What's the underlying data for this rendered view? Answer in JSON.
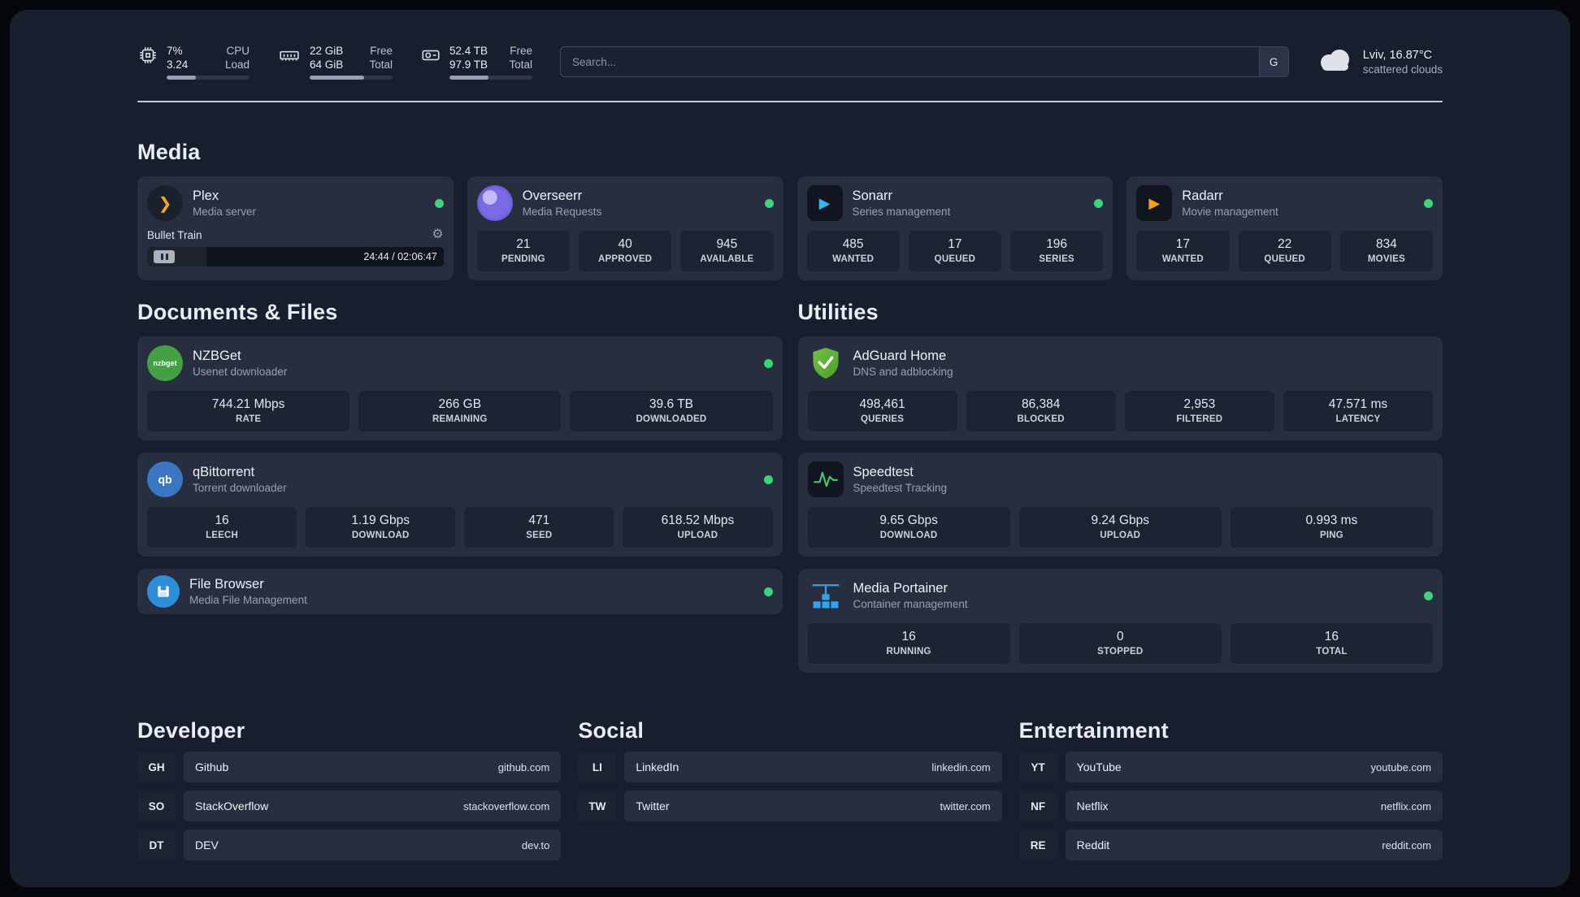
{
  "topbar": {
    "cpu": {
      "value": "7%",
      "load": "3.24",
      "label1": "CPU",
      "label2": "Load",
      "percent": 35
    },
    "memory": {
      "free": "22 GiB",
      "total": "64 GiB",
      "label1": "Free",
      "label2": "Total",
      "percent": 66
    },
    "disk": {
      "free": "52.4 TB",
      "total": "97.9 TB",
      "label1": "Free",
      "label2": "Total",
      "percent": 47
    },
    "search": {
      "placeholder": "Search...",
      "engine": "G"
    },
    "weather": {
      "location": "Lviv, 16.87°C",
      "condition": "scattered clouds"
    }
  },
  "sections": {
    "media": "Media",
    "documents": "Documents & Files",
    "utilities": "Utilities",
    "developer": "Developer",
    "social": "Social",
    "entertainment": "Entertainment"
  },
  "apps": {
    "plex": {
      "name": "Plex",
      "desc": "Media server",
      "icon_glyph": "❯",
      "now_playing": "Bullet Train",
      "time": "24:44 / 02:06:47",
      "progress": 20
    },
    "overseerr": {
      "name": "Overseerr",
      "desc": "Media Requests",
      "stats": [
        {
          "v": "21",
          "l": "PENDING"
        },
        {
          "v": "40",
          "l": "APPROVED"
        },
        {
          "v": "945",
          "l": "AVAILABLE"
        }
      ]
    },
    "sonarr": {
      "name": "Sonarr",
      "desc": "Series management",
      "icon_glyph": "▶",
      "stats": [
        {
          "v": "485",
          "l": "WANTED"
        },
        {
          "v": "17",
          "l": "QUEUED"
        },
        {
          "v": "196",
          "l": "SERIES"
        }
      ]
    },
    "radarr": {
      "name": "Radarr",
      "desc": "Movie management",
      "icon_glyph": "▶",
      "stats": [
        {
          "v": "17",
          "l": "WANTED"
        },
        {
          "v": "22",
          "l": "QUEUED"
        },
        {
          "v": "834",
          "l": "MOVIES"
        }
      ]
    },
    "nzbget": {
      "name": "NZBGet",
      "desc": "Usenet downloader",
      "icon_text": "nzbget",
      "stats": [
        {
          "v": "744.21 Mbps",
          "l": "RATE"
        },
        {
          "v": "266 GB",
          "l": "REMAINING"
        },
        {
          "v": "39.6 TB",
          "l": "DOWNLOADED"
        }
      ]
    },
    "qbittorrent": {
      "name": "qBittorrent",
      "desc": "Torrent downloader",
      "icon_text": "qb",
      "stats": [
        {
          "v": "16",
          "l": "LEECH"
        },
        {
          "v": "1.19 Gbps",
          "l": "DOWNLOAD"
        },
        {
          "v": "471",
          "l": "SEED"
        },
        {
          "v": "618.52 Mbps",
          "l": "UPLOAD"
        }
      ]
    },
    "filebrowser": {
      "name": "File Browser",
      "desc": "Media File Management"
    },
    "adguard": {
      "name": "AdGuard Home",
      "desc": "DNS and adblocking",
      "stats": [
        {
          "v": "498,461",
          "l": "QUERIES"
        },
        {
          "v": "86,384",
          "l": "BLOCKED"
        },
        {
          "v": "2,953",
          "l": "FILTERED"
        },
        {
          "v": "47.571 ms",
          "l": "LATENCY"
        }
      ]
    },
    "speedtest": {
      "name": "Speedtest",
      "desc": "Speedtest Tracking",
      "stats": [
        {
          "v": "9.65 Gbps",
          "l": "DOWNLOAD"
        },
        {
          "v": "9.24 Gbps",
          "l": "UPLOAD"
        },
        {
          "v": "0.993 ms",
          "l": "PING"
        }
      ]
    },
    "portainer": {
      "name": "Media Portainer",
      "desc": "Container management",
      "stats": [
        {
          "v": "16",
          "l": "RUNNING"
        },
        {
          "v": "0",
          "l": "STOPPED"
        },
        {
          "v": "16",
          "l": "TOTAL"
        }
      ]
    }
  },
  "bookmarks": {
    "developer": [
      {
        "abbr": "GH",
        "name": "Github",
        "url": "github.com"
      },
      {
        "abbr": "SO",
        "name": "StackOverflow",
        "url": "stackoverflow.com"
      },
      {
        "abbr": "DT",
        "name": "DEV",
        "url": "dev.to"
      }
    ],
    "social": [
      {
        "abbr": "LI",
        "name": "LinkedIn",
        "url": "linkedin.com"
      },
      {
        "abbr": "TW",
        "name": "Twitter",
        "url": "twitter.com"
      }
    ],
    "entertainment": [
      {
        "abbr": "YT",
        "name": "YouTube",
        "url": "youtube.com"
      },
      {
        "abbr": "NF",
        "name": "Netflix",
        "url": "netflix.com"
      },
      {
        "abbr": "RE",
        "name": "Reddit",
        "url": "reddit.com"
      }
    ]
  },
  "colors": {
    "status_online": "#3ed47e",
    "accent_amber": "#f0a81e",
    "accent_blue": "#38b6e9"
  }
}
